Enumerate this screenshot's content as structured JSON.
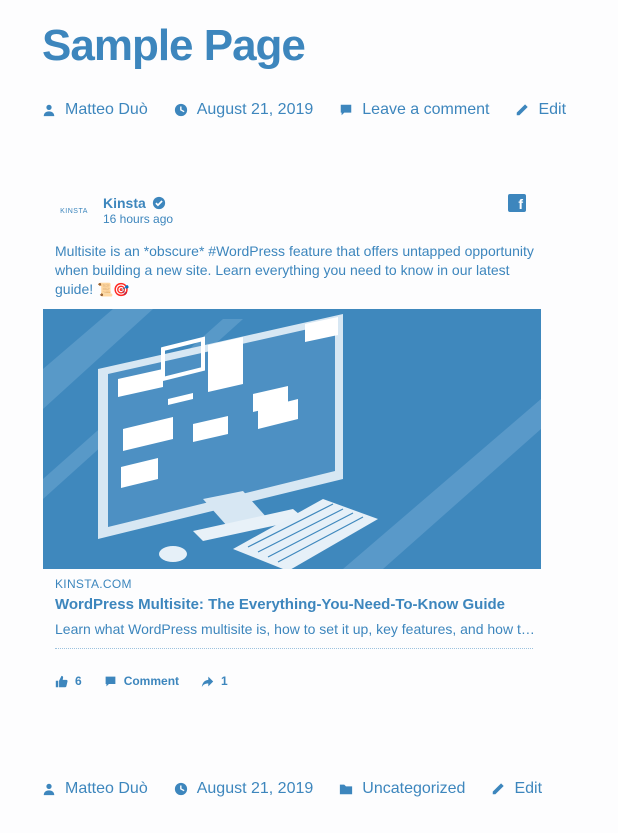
{
  "page": {
    "title": "Sample Page"
  },
  "meta_top": {
    "author": "Matteo Duò",
    "date": "August 21, 2019",
    "comments": "Leave a comment",
    "edit": "Edit"
  },
  "post": {
    "avatar_text": "KINSTA",
    "author": "Kinsta",
    "time": "16 hours ago",
    "text": "Multisite is an *obscure* #WordPress feature that offers untapped opportunity when building a new site. Learn everything you need to know in our latest guide!",
    "emoji": "📜🎯",
    "domain": "KINSTA.COM",
    "link_title": "WordPress Multisite: The Everything-You-Need-To-Know Guide",
    "link_desc": "Learn what WordPress multisite is, how to set it up, key features, and how to manage it",
    "likes": "6",
    "comment_label": "Comment",
    "shares": "1"
  },
  "meta_bottom": {
    "author": "Matteo Duò",
    "date": "August 21, 2019",
    "category": "Uncategorized",
    "edit": "Edit"
  },
  "colors": {
    "accent": "#3d86bd",
    "background": "#fdfdfe"
  }
}
